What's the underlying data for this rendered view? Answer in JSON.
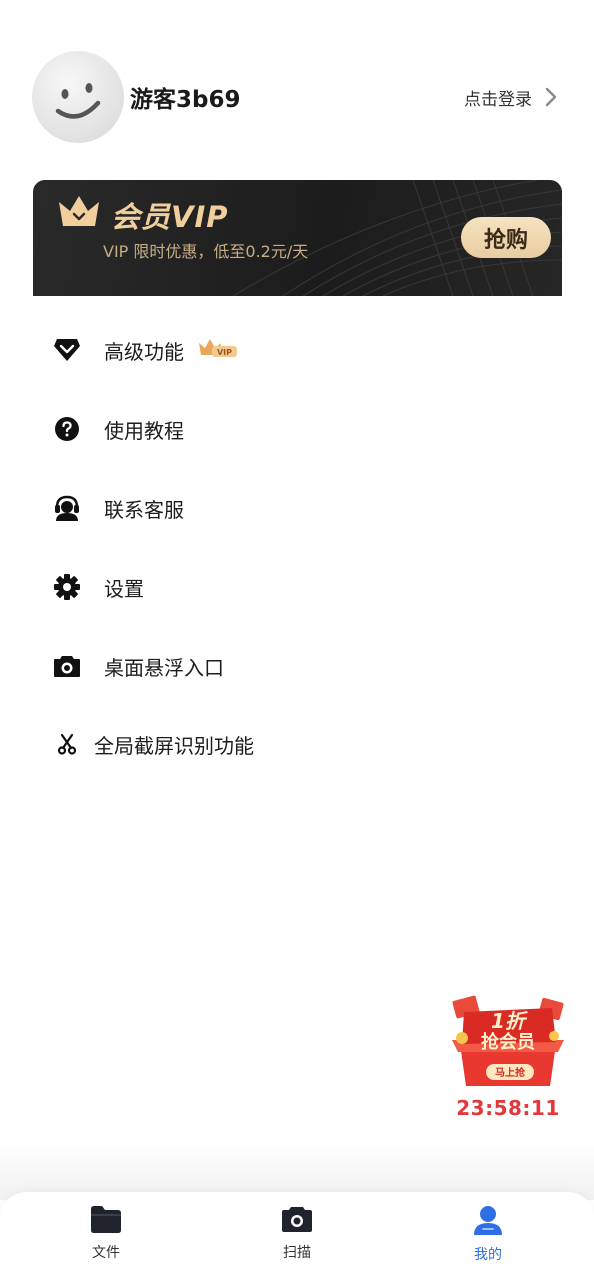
{
  "profile": {
    "username": "游客3b69",
    "login_label": "点击登录"
  },
  "vip": {
    "title": "会员VIP",
    "subtitle": "VIP 限时优惠，低至0.2元/天",
    "buy_label": "抢购"
  },
  "menu": {
    "items": [
      {
        "label": "高级功能",
        "icon": "diamond-icon",
        "badge": "VIP"
      },
      {
        "label": "使用教程",
        "icon": "help-circle-icon"
      },
      {
        "label": "联系客服",
        "icon": "customer-service-icon"
      },
      {
        "label": "设置",
        "icon": "gear-icon"
      },
      {
        "label": "桌面悬浮入口",
        "icon": "camera-icon"
      },
      {
        "label": "全局截屏识别功能",
        "icon": "scissors-icon"
      }
    ]
  },
  "promo": {
    "discount": "1折",
    "headline": "抢会员",
    "button": "马上抢",
    "timer": "23:58:11"
  },
  "bottom_nav": {
    "items": [
      {
        "label": "文件",
        "icon": "folder-icon",
        "active": false
      },
      {
        "label": "扫描",
        "icon": "camera-icon",
        "active": false
      },
      {
        "label": "我的",
        "icon": "user-icon",
        "active": true
      }
    ]
  },
  "colors": {
    "accent": "#2e6fe6",
    "vip_gold": "#f0cf9c",
    "vip_background": "#1f1f1f",
    "promo_red": "#e3383b"
  }
}
